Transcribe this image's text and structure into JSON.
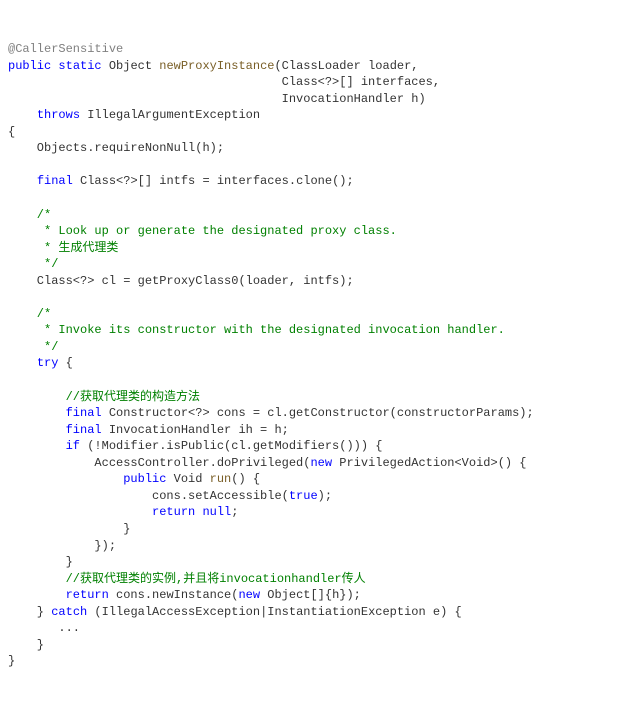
{
  "code": {
    "l01_ann": "@CallerSensitive",
    "l02_a": "public",
    "l02_b": "static",
    "l02_c": " Object ",
    "l02_d": "newProxyInstance",
    "l02_e": "(ClassLoader loader,",
    "l03": "                                      Class<?>[] interfaces,",
    "l04": "                                      InvocationHandler h)",
    "l05_a": "    ",
    "l05_b": "throws",
    "l05_c": " IllegalArgumentException",
    "l06": "{",
    "l07_a": "    Objects.requireNonNull(",
    "l07_b": "h",
    "l07_c": ");",
    "l08": "",
    "l09_a": "    ",
    "l09_b": "final",
    "l09_c": " Class<?>[] intfs = interfaces.clone();",
    "l10": "",
    "l11": "    /*",
    "l12": "     * Look up or generate the designated proxy class.",
    "l13": "     * 生成代理类",
    "l14": "     */",
    "l15": "    Class<?> cl = getProxyClass0(loader, intfs);",
    "l16": "",
    "l17": "    /*",
    "l18": "     * Invoke its constructor with the designated invocation handler.",
    "l19": "     */",
    "l20_a": "    ",
    "l20_b": "try",
    "l20_c": " {",
    "l21": "",
    "l22": "        //获取代理类的构造方法",
    "l23_a": "        ",
    "l23_b": "final",
    "l23_c": " Constructor<?> cons = cl.getConstructor(constructorParams);",
    "l24_a": "        ",
    "l24_b": "final",
    "l24_c": " InvocationHandler ih = h;",
    "l25_a": "        ",
    "l25_b": "if",
    "l25_c": " (!Modifier.isPublic(cl.getModifiers())) {",
    "l26_a": "            AccessController.doPrivileged(",
    "l26_b": "new",
    "l26_c": " PrivilegedAction<Void>() {",
    "l27_a": "                ",
    "l27_b": "public",
    "l27_c": " Void ",
    "l27_d": "run",
    "l27_e": "() {",
    "l28_a": "                    cons.setAccessible(",
    "l28_b": "true",
    "l28_c": ");",
    "l29_a": "                    ",
    "l29_b": "return",
    "l29_c": " ",
    "l29_d": "null",
    "l29_e": ";",
    "l30": "                }",
    "l31": "            });",
    "l32": "        }",
    "l33": "        //获取代理类的实例,并且将invocationhandler传人",
    "l34_a": "        ",
    "l34_b": "return",
    "l34_c": " cons.newInstance(",
    "l34_d": "new",
    "l34_e": " Object[]{",
    "l34_f": "h",
    "l34_g": "});",
    "l35_a": "    } ",
    "l35_b": "catch",
    "l35_c": " (IllegalAccessException|InstantiationException e) {",
    "l36": "       ...",
    "l37": "    }",
    "l38": "}"
  }
}
